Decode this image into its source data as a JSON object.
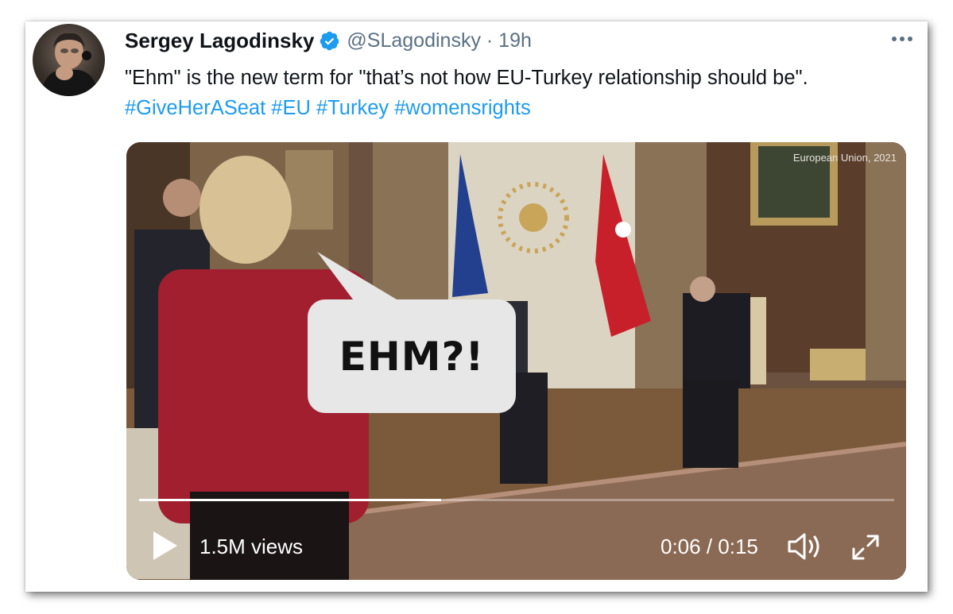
{
  "tweet": {
    "author_name": "Sergey Lagodinsky",
    "handle_time": "@SLagodinsky · 19h",
    "text_plain": "\"Ehm\" is the new term for \"that’s not how EU-Turkey relationship should be\". ",
    "hashtags": [
      "#GiveHerASeat",
      "#EU",
      "#Turkey",
      "#womensrights"
    ]
  },
  "icons": {
    "avatar": "avatar",
    "verified": "verified-badge-icon",
    "more": "more-options-icon",
    "play": "play-icon",
    "volume": "volume-icon",
    "fullscreen": "fullscreen-icon"
  },
  "media": {
    "watermark": "European Union, 2021",
    "speech_bubble": "EHM?!",
    "views": "1.5M views",
    "time": "0:06 / 0:15",
    "progress": 0.4
  },
  "colors": {
    "link": "#1d9bf0",
    "verified": "#1d9bf0",
    "secondary_text": "#5b7083"
  }
}
